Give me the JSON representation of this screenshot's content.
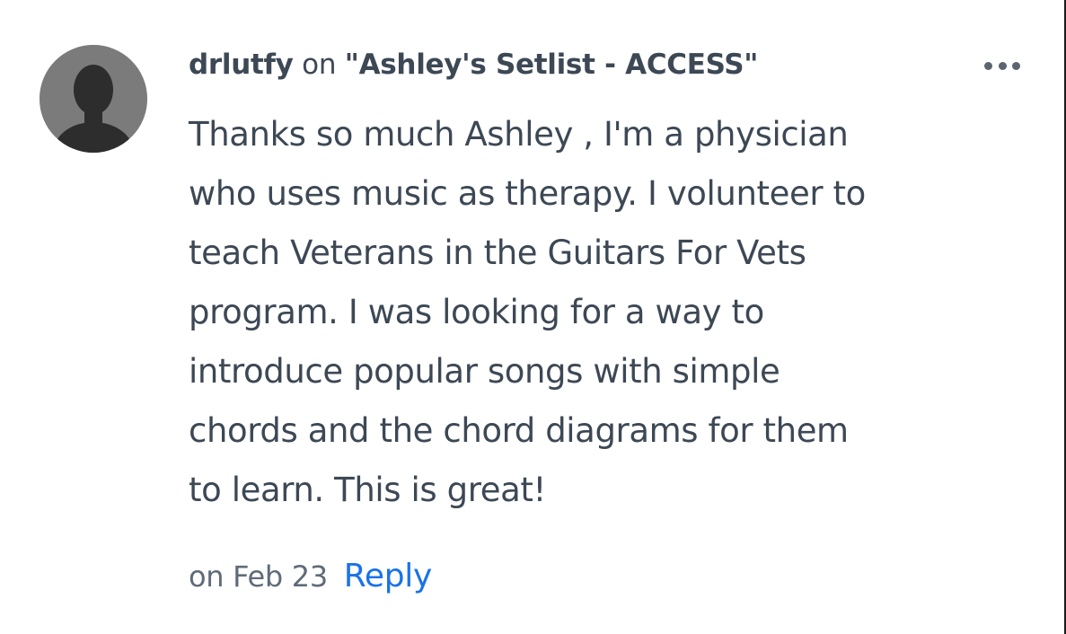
{
  "comment": {
    "author": "drlutfy",
    "on_word": "on",
    "post_title": "Ashley's Setlist - ACCESS",
    "body_lines": [
      "Thanks so much Ashley , I'm a physician",
      "who uses music as therapy. I volunteer to",
      "teach Veterans in the Guitars For Vets",
      "program. I was looking for a way to",
      "introduce popular songs with simple",
      "chords and the chord diagrams for them",
      "to learn. This is great!"
    ],
    "date": "on Feb 23",
    "reply_label": "Reply",
    "avatar_icon": "default-user-avatar-icon",
    "more_icon": "more-options-icon"
  },
  "colors": {
    "text": "#3d4855",
    "muted": "#5f6b78",
    "link": "#1a73e8",
    "avatar_bg": "#7a7a7a",
    "avatar_silhouette": "#2f2f2f"
  }
}
